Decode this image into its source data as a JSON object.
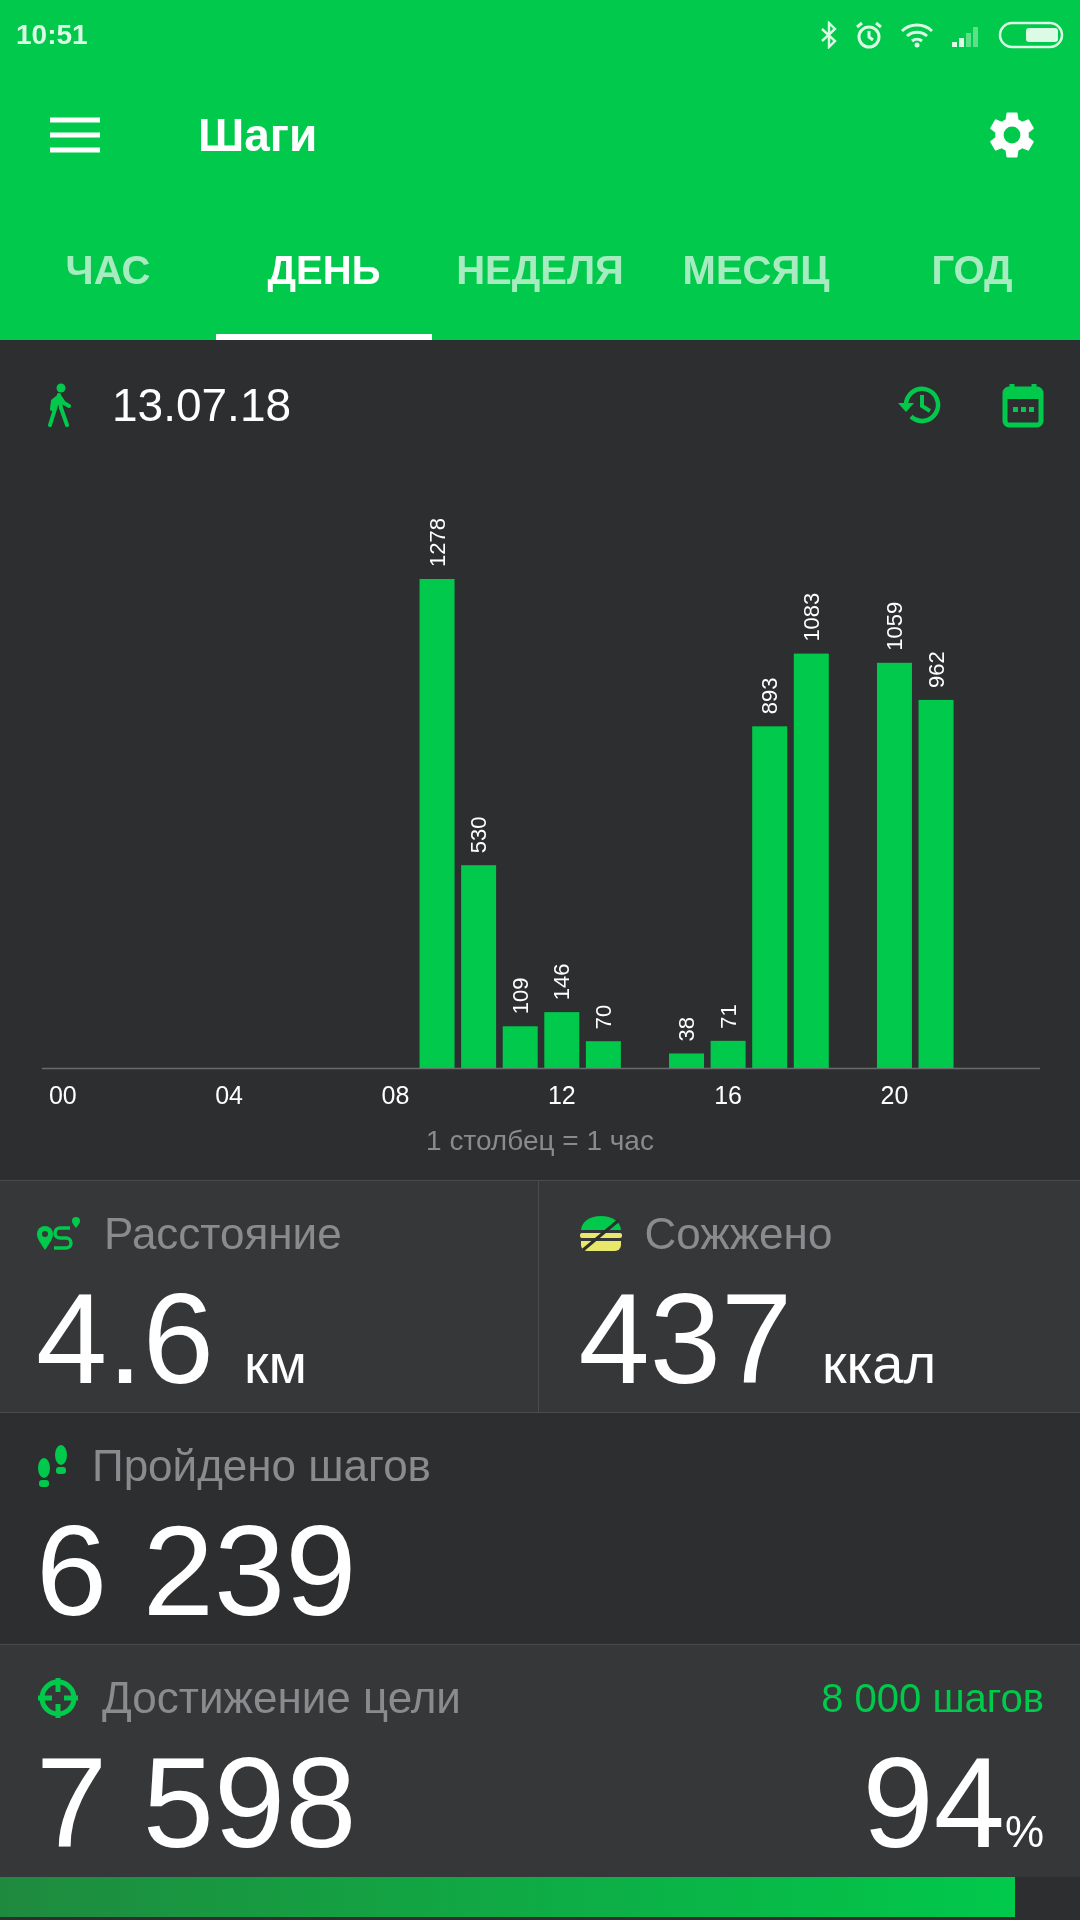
{
  "status_bar": {
    "time": "10:51"
  },
  "app_bar": {
    "title": "Шаги"
  },
  "tabs": [
    {
      "label": "ЧАС",
      "selected": false
    },
    {
      "label": "ДЕНЬ",
      "selected": true
    },
    {
      "label": "НЕДЕЛЯ",
      "selected": false
    },
    {
      "label": "МЕСЯЦ",
      "selected": false
    },
    {
      "label": "ГОД",
      "selected": false
    }
  ],
  "date_row": {
    "date": "13.07.18"
  },
  "chart": {
    "caption": "1 столбец = 1 час",
    "chart_data": {
      "type": "bar",
      "x": [
        9,
        10,
        11,
        12,
        13,
        15,
        16,
        17,
        18,
        20,
        21
      ],
      "values": [
        1278,
        530,
        109,
        146,
        70,
        38,
        71,
        893,
        1083,
        1059,
        962
      ],
      "xticks": [
        {
          "value": 0,
          "label": "00"
        },
        {
          "value": 4,
          "label": "04"
        },
        {
          "value": 8,
          "label": "08"
        },
        {
          "value": 12,
          "label": "12"
        },
        {
          "value": 16,
          "label": "16"
        },
        {
          "value": 20,
          "label": "20"
        }
      ],
      "xlim": [
        -0.5,
        23.5
      ],
      "data_labels": true
    }
  },
  "stats": [
    {
      "kind": "distance",
      "label": "Расстояние",
      "value": "4.6",
      "unit": "км"
    },
    {
      "kind": "calories",
      "label": "Сожжено",
      "value": "437",
      "unit": "ккал"
    },
    {
      "kind": "steps",
      "label": "Пройдено шагов",
      "value": "6 239"
    }
  ],
  "goal": {
    "label": "Достижение цели",
    "target": "8 000 шагов",
    "value": "7 598",
    "percent": "94",
    "percent_unit": "%",
    "level": 0.94
  }
}
